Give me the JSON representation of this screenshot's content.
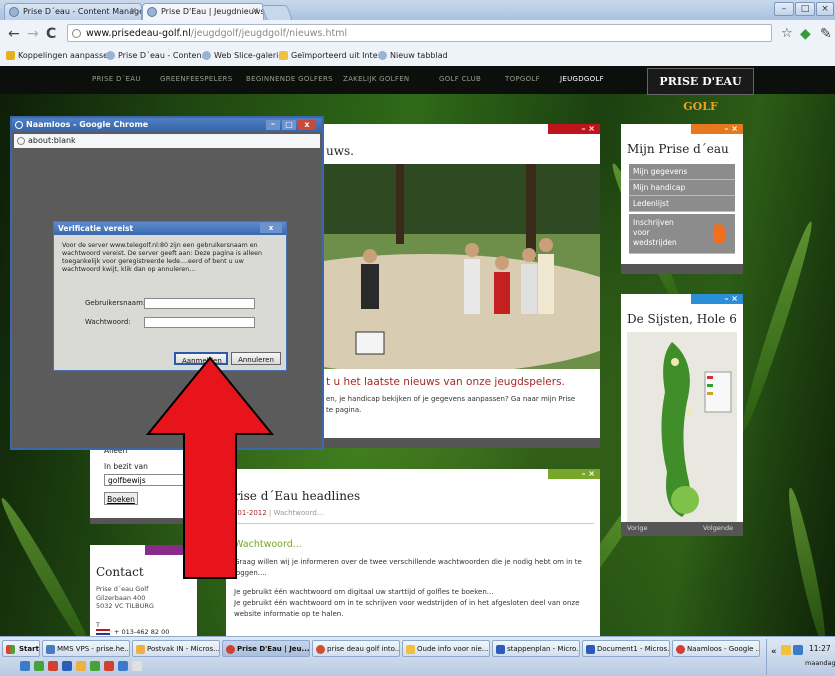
{
  "browser": {
    "tabs": [
      {
        "label": "Prise D´eau - Content Manage"
      },
      {
        "label": "Prise D'Eau | Jeugdnieuws"
      }
    ],
    "url_domain": "www.prisedeau-golf.nl",
    "url_path": "/jeugdgolf/jeugdgolf/nieuws.html",
    "bookmarks": [
      {
        "label": "Koppelingen aanpassen"
      },
      {
        "label": "Prise D´eau - Conten..."
      },
      {
        "label": "Web Slice-galerie"
      },
      {
        "label": "Geïmporteerd uit Inte..."
      },
      {
        "label": "Nieuw tabblad"
      }
    ]
  },
  "site": {
    "nav": [
      "PRISE D´EAU",
      "GREENFEESPELERS",
      "BEGINNENDE GOLFERS",
      "ZAKELIJK GOLFEN",
      "GOLF CLUB",
      "TOPGOLF",
      "JEUGDGOLF"
    ],
    "logo_main": "PRISE D'EAU",
    "logo_accent": "GOLF",
    "news_title_fragment": "uws.",
    "news_headline": "t u het laatste nieuws van onze jeugdspelers.",
    "news_body": "en, je handicap bekijken of je gegevens aanpassen? Ga naar mijn Prise\nte pagina.",
    "headlines_title": "Prise d´Eau headlines",
    "headlines_date": "19-01-2012",
    "headlines_category": "Wachtwoord...",
    "article_title": "Wachtwoord...",
    "article_lines": [
      "Graag willen wij je informeren over de twee verschillende wachtwoorden die je nodig hebt om in te loggen....",
      "Je gebruikt één wachtwoord om digitaal uw starttijd of golfles te boeken...",
      "Je gebruikt één wachtwoord om in te schrijven voor wedstrijden of in het afgesloten deel van onze website informatie op te halen."
    ],
    "mijn_title": "Mijn Prise d´eau",
    "mijn_items": [
      "Mijn gegevens",
      "Mijn handicap",
      "Ledenlijst"
    ],
    "inschrijven_label": "Inschrijven voor wedstrijden",
    "sijsten_title": "De Sijsten, Hole 6",
    "sijsten_prev": "Vorige",
    "sijsten_next": "Volgende",
    "booking_fragment": "Alleen",
    "booking_label": "In bezit van",
    "booking_select": "golfbewijs",
    "booking_button": "Boeken",
    "contact_title": "Contact",
    "contact_lines": [
      "Prise d´eau Golf",
      "Gilzerbaan 400",
      "5032 VC TILBURG"
    ],
    "contact_t": "T",
    "contact_phone": "+ 013-462 82 00"
  },
  "popup": {
    "title": "Naamloos - Google Chrome",
    "address": "about:blank",
    "dialog_title": "Verificatie vereist",
    "dialog_message": "Voor de server www.telegolf.nl:80 zijn een gebruikersnaam en wachtwoord vereist. De server geeft aan: Deze pagina is alleen toegankelijk voor geregistreerde lede....eerd of bent u uw wachtwoord kwijt, klik dan op annuleren...",
    "username_label": "Gebruikersnaam:",
    "password_label": "Wachtwoord:",
    "login_button": "Aanmelden",
    "cancel_button": "Annuleren"
  },
  "taskbar": {
    "start": "Start",
    "items": [
      "MMS VPS - prise.he...",
      "Postvak IN - Micros...",
      "Prise D'Eau | Jeu...",
      "prise deau golf into...",
      "Oude info voor nie...",
      "stappenplan - Micro...",
      "Document1 - Micros...",
      "Naamloos - Google ..."
    ],
    "clock_time": "11:27",
    "clock_day": "maandag"
  },
  "colors": {
    "arrow": "#e8141c",
    "accent_red": "#c0141c",
    "accent_orange": "#e6781e",
    "accent_blue": "#2a8fd6",
    "accent_green": "#78a628",
    "accent_purple": "#8a2a8a"
  }
}
